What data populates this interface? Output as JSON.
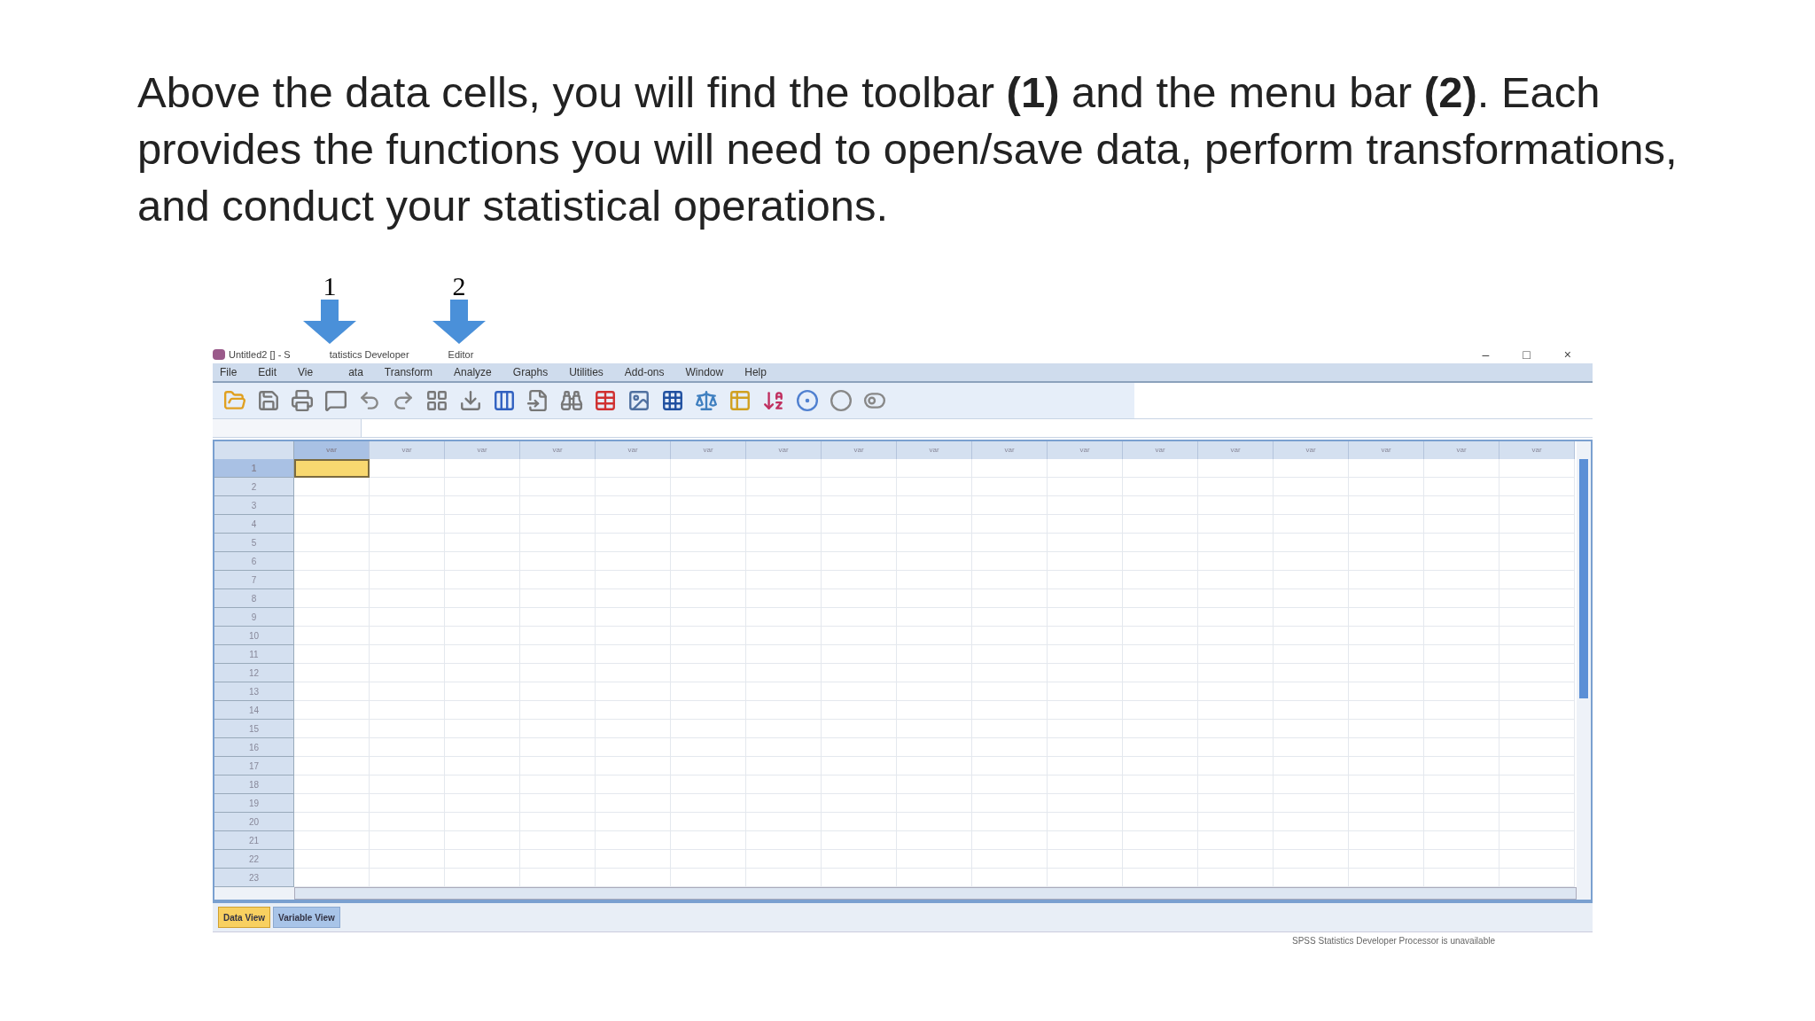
{
  "slide_text": "Above the data cells, you will find the toolbar **(1)** and the menu bar **(2)**. Each provides the functions you will need to open/save data, perform transformations, and conduct your statistical operations.",
  "annotations": [
    {
      "label": "1"
    },
    {
      "label": "2"
    }
  ],
  "window": {
    "title_parts": [
      "Untitled2 [] - S",
      "tatistics Developer",
      "Editor"
    ],
    "controls": [
      "–",
      "□",
      "×"
    ]
  },
  "menu_bar": [
    "File",
    "Edit",
    "Vie",
    "ata",
    "Transform",
    "Analyze",
    "Graphs",
    "Utilities",
    "Add-ons",
    "Window",
    "Help"
  ],
  "grid": {
    "columns": [
      {
        "label": "var",
        "active": true
      },
      {
        "label": "var",
        "active": false
      },
      {
        "label": "var",
        "active": false
      },
      {
        "label": "var",
        "active": false
      },
      {
        "label": "var",
        "active": false
      },
      {
        "label": "var",
        "active": false
      },
      {
        "label": "var",
        "active": false
      },
      {
        "label": "var",
        "active": false
      },
      {
        "label": "var",
        "active": false
      },
      {
        "label": "var",
        "active": false
      },
      {
        "label": "var",
        "active": false
      },
      {
        "label": "var",
        "active": false
      },
      {
        "label": "var",
        "active": false
      },
      {
        "label": "var",
        "active": false
      },
      {
        "label": "var",
        "active": false
      },
      {
        "label": "var",
        "active": false
      },
      {
        "label": "var",
        "active": false
      }
    ],
    "rows": [
      {
        "label": "1",
        "active": true
      },
      {
        "label": "2",
        "active": false
      },
      {
        "label": "3",
        "active": false
      },
      {
        "label": "4",
        "active": false
      },
      {
        "label": "5",
        "active": false
      },
      {
        "label": "6",
        "active": false
      },
      {
        "label": "7",
        "active": false
      },
      {
        "label": "8",
        "active": false
      },
      {
        "label": "9",
        "active": false
      },
      {
        "label": "10",
        "active": false
      },
      {
        "label": "11",
        "active": false
      },
      {
        "label": "12",
        "active": false
      },
      {
        "label": "13",
        "active": false
      },
      {
        "label": "14",
        "active": false
      },
      {
        "label": "15",
        "active": false
      },
      {
        "label": "16",
        "active": false
      },
      {
        "label": "17",
        "active": false
      },
      {
        "label": "18",
        "active": false
      },
      {
        "label": "19",
        "active": false
      },
      {
        "label": "20",
        "active": false
      },
      {
        "label": "21",
        "active": false
      },
      {
        "label": "22",
        "active": false
      },
      {
        "label": "23",
        "active": false
      }
    ]
  },
  "view_tabs": [
    {
      "label": "Data View",
      "selected": true
    },
    {
      "label": "Variable View",
      "selected": false
    }
  ],
  "status_bar": "SPSS Statistics Developer Processor is unavailable"
}
